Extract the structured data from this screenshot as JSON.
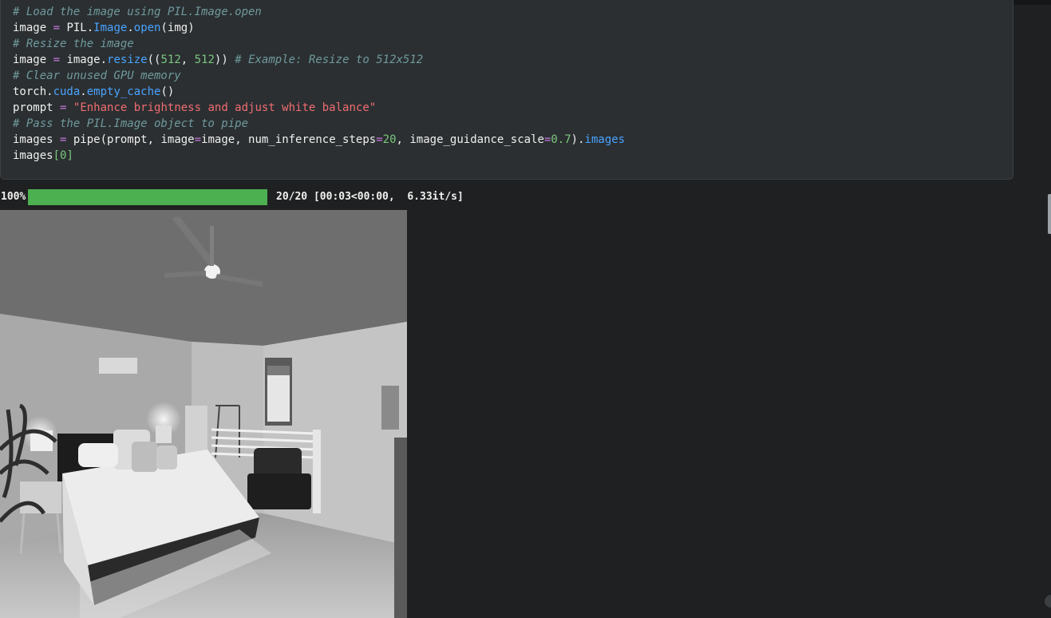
{
  "code_lines": [
    [
      {
        "t": "# Load the image using PIL.Image.open",
        "c": "com"
      }
    ],
    [
      {
        "t": "image ",
        "c": "plain"
      },
      {
        "t": "=",
        "c": "op"
      },
      {
        "t": " PIL.",
        "c": "plain"
      },
      {
        "t": "Image",
        "c": "fn"
      },
      {
        "t": ".",
        "c": "plain"
      },
      {
        "t": "open",
        "c": "fn"
      },
      {
        "t": "(img)",
        "c": "plain"
      }
    ],
    [
      {
        "t": "# Resize the image",
        "c": "com"
      }
    ],
    [
      {
        "t": "image ",
        "c": "plain"
      },
      {
        "t": "=",
        "c": "op"
      },
      {
        "t": " image.",
        "c": "plain"
      },
      {
        "t": "resize",
        "c": "fn"
      },
      {
        "t": "((",
        "c": "plain"
      },
      {
        "t": "512",
        "c": "num"
      },
      {
        "t": ", ",
        "c": "plain"
      },
      {
        "t": "512",
        "c": "num"
      },
      {
        "t": ")) ",
        "c": "plain"
      },
      {
        "t": "# Example: Resize to 512x512",
        "c": "com"
      }
    ],
    [
      {
        "t": "# Clear unused GPU memory",
        "c": "com"
      }
    ],
    [
      {
        "t": "torch.",
        "c": "plain"
      },
      {
        "t": "cuda",
        "c": "fn"
      },
      {
        "t": ".",
        "c": "plain"
      },
      {
        "t": "empty_cache",
        "c": "fn"
      },
      {
        "t": "()",
        "c": "plain"
      }
    ],
    [
      {
        "t": "prompt ",
        "c": "plain"
      },
      {
        "t": "=",
        "c": "op"
      },
      {
        "t": " ",
        "c": "plain"
      },
      {
        "t": "\"Enhance brightness and adjust white balance\"",
        "c": "str"
      }
    ],
    [
      {
        "t": "# Pass the PIL.Image object to pipe",
        "c": "com"
      }
    ],
    [
      {
        "t": "images ",
        "c": "plain"
      },
      {
        "t": "=",
        "c": "op"
      },
      {
        "t": " pipe(prompt, image",
        "c": "plain"
      },
      {
        "t": "=",
        "c": "op"
      },
      {
        "t": "image, num_inference_steps",
        "c": "plain"
      },
      {
        "t": "=",
        "c": "op"
      },
      {
        "t": "20",
        "c": "num"
      },
      {
        "t": ", image_guidance_scale",
        "c": "plain"
      },
      {
        "t": "=",
        "c": "op"
      },
      {
        "t": "0.7",
        "c": "num"
      },
      {
        "t": ").",
        "c": "plain"
      },
      {
        "t": "images",
        "c": "fn"
      }
    ],
    [
      {
        "t": "images",
        "c": "plain"
      },
      {
        "t": "[",
        "c": "num"
      },
      {
        "t": "0",
        "c": "num"
      },
      {
        "t": "]",
        "c": "num"
      }
    ]
  ],
  "progress": {
    "percent_label": "100%",
    "fraction": 1.0,
    "stats": "20/20 [00:03<00:00,  6.33it/s]"
  },
  "colors": {
    "progress_fill": "#4caf50",
    "comment": "#6f9a9e",
    "operator": "#c678dd",
    "function": "#4aa3ff",
    "number": "#7bc67e",
    "string": "#f06d72"
  }
}
